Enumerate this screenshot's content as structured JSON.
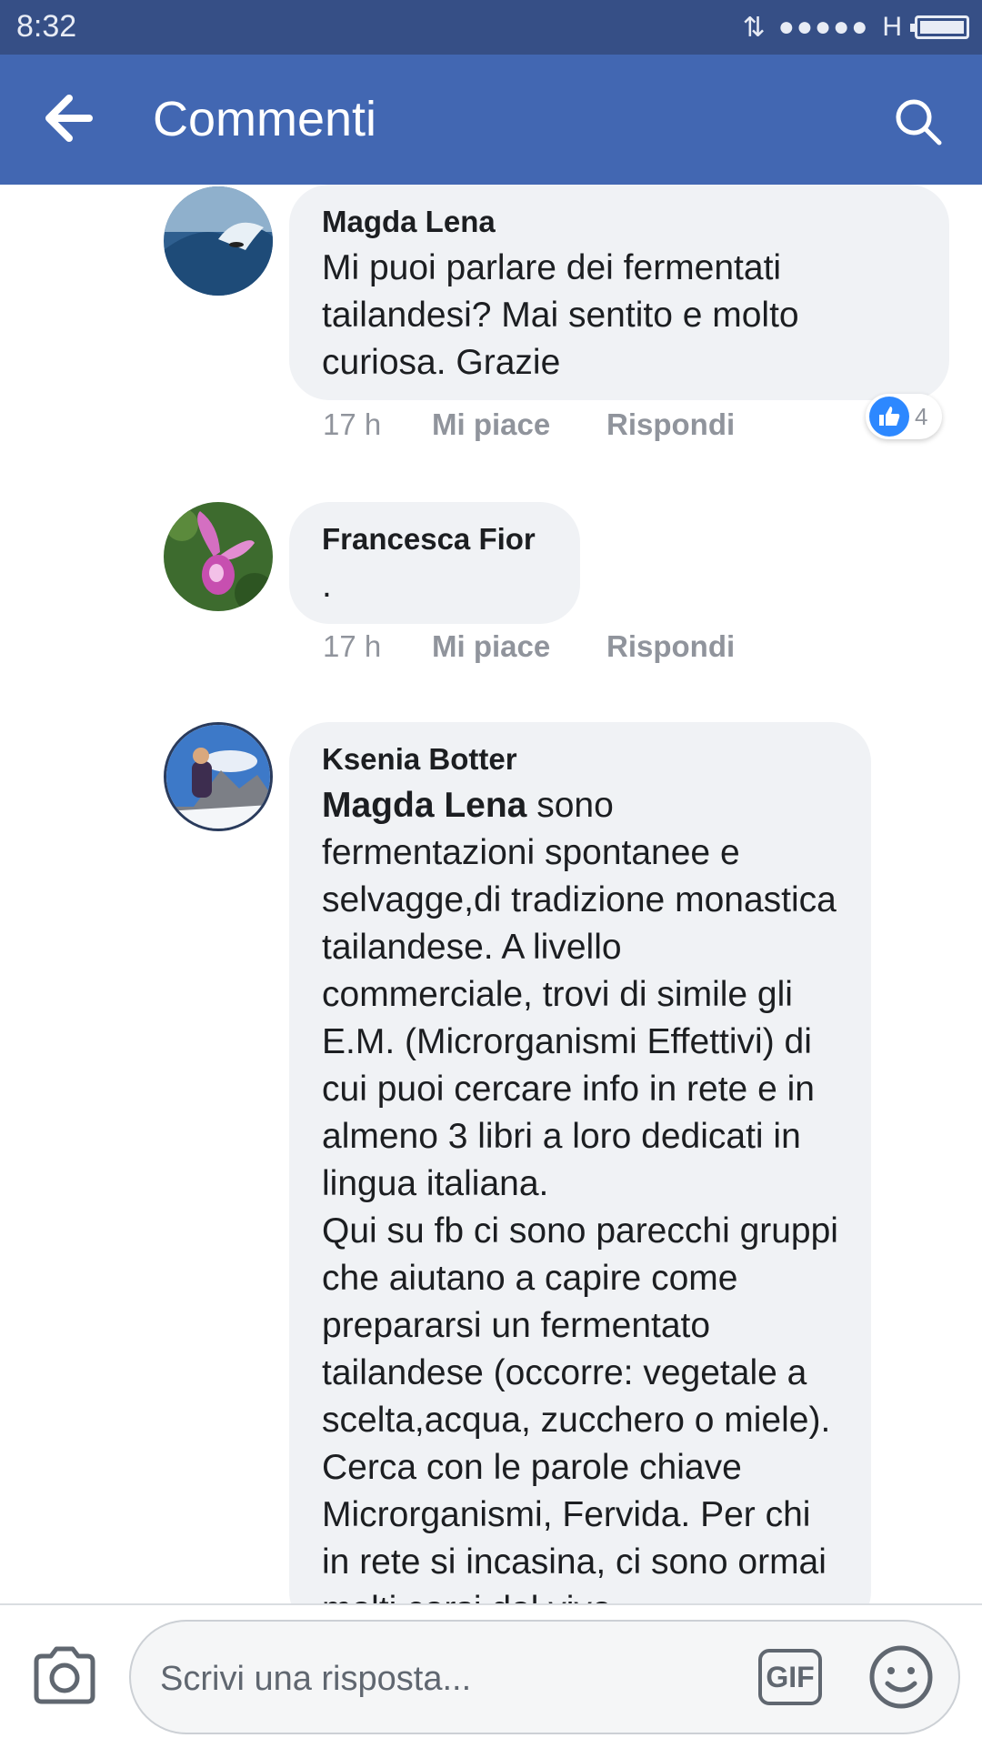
{
  "status_bar": {
    "time": "8:32",
    "network": "H"
  },
  "app_bar": {
    "title": "Commenti"
  },
  "comments": [
    {
      "author": "Magda Lena",
      "text": "Mi puoi parlare dei fermentati tailandesi? Mai sentito e molto curiosa. Grazie",
      "time": "17 h",
      "like_label": "Mi piace",
      "reply_label": "Rispondi",
      "reaction_count": "4"
    },
    {
      "author": "Francesca Fior",
      "text": ".",
      "time": "17 h",
      "like_label": "Mi piace",
      "reply_label": "Rispondi"
    },
    {
      "author": "Ksenia Botter",
      "mention": "Magda Lena",
      "text_line1": " sono",
      "text_body": "fermentazioni spontanee e selvagge,di tradizione monastica tailandese. A livello commerciale, trovi di simile gli E.M. (Microrganismi Effettivi) di cui puoi cercare info in rete e in almeno 3 libri a loro dedicati in lingua italiana.",
      "text_body2": "Qui su fb ci sono parecchi gruppi che aiutano a capire come prepararsi un fermentato tailandese (occorre: vegetale a scelta,acqua, zucchero o miele). Cerca con le parole chiave Microrganismi, Fervida. Per chi in rete si incasina, ci sono ormai molti corsi dal vivo"
    }
  ],
  "composer": {
    "placeholder": "Scrivi una risposta...",
    "gif_label": "GIF"
  },
  "colors": {
    "appbar": "#4267b2",
    "statusbar": "#364f86",
    "bubble": "#f0f2f5",
    "like_blue": "#2d88ff"
  }
}
